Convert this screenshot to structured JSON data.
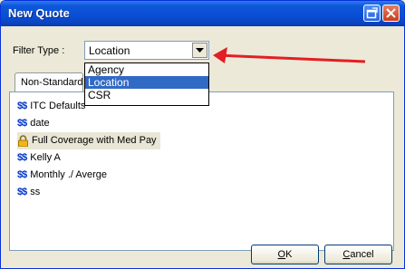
{
  "window": {
    "title": "New Quote"
  },
  "filter": {
    "label": "Filter Type :",
    "value": "Location",
    "options": [
      "Agency",
      "Location",
      "CSR"
    ],
    "selected_index": 1
  },
  "tabs": [
    {
      "label": "Non-Standard"
    }
  ],
  "quotes": [
    {
      "icon": "$$",
      "label": "ITC Defaults"
    },
    {
      "icon": "$$",
      "label": "date"
    },
    {
      "icon": "lock-icon",
      "label": "Full Coverage with Med Pay"
    },
    {
      "icon": "$$",
      "label": "Kelly A"
    },
    {
      "icon": "$$",
      "label": "Monthly ./ Averge"
    },
    {
      "icon": "$$",
      "label": "ss"
    }
  ],
  "buttons": {
    "ok_mnemonic": "O",
    "ok_rest": "K",
    "cancel_mnemonic": "C",
    "cancel_rest": "ancel"
  },
  "colors": {
    "title_bar": "#0a4fd6",
    "selection": "#316ac5",
    "annotation_arrow": "#e31e24",
    "dollar_icon": "#0033cc"
  }
}
